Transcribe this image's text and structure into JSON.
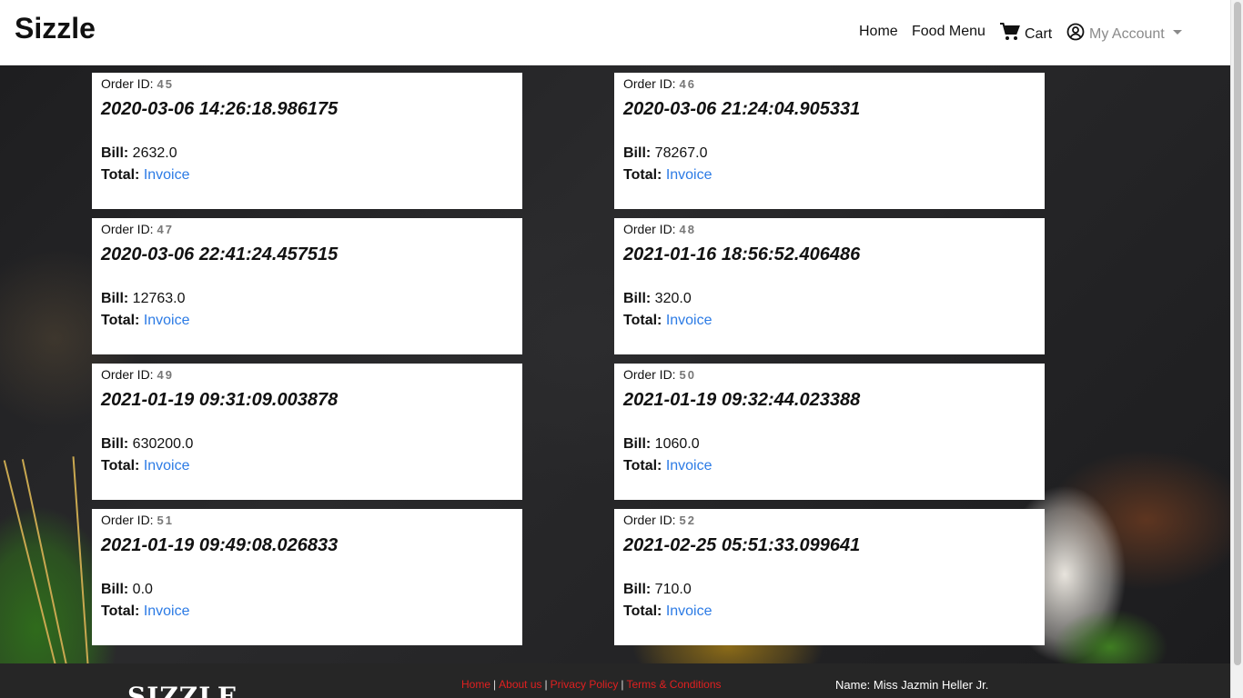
{
  "navbar": {
    "brand": "Sizzle",
    "home": "Home",
    "food_menu": "Food Menu",
    "cart": "Cart",
    "my_account": "My Account"
  },
  "labels": {
    "order_id": "Order ID:",
    "bill": "Bill:",
    "total": "Total:",
    "invoice": "Invoice"
  },
  "orders": [
    {
      "id": "45",
      "timestamp": "2020-03-06 14:26:18.986175",
      "bill": "2632.0"
    },
    {
      "id": "46",
      "timestamp": "2020-03-06 21:24:04.905331",
      "bill": "78267.0"
    },
    {
      "id": "47",
      "timestamp": "2020-03-06 22:41:24.457515",
      "bill": "12763.0"
    },
    {
      "id": "48",
      "timestamp": "2021-01-16 18:56:52.406486",
      "bill": "320.0"
    },
    {
      "id": "49",
      "timestamp": "2021-01-19 09:31:09.003878",
      "bill": "630200.0"
    },
    {
      "id": "50",
      "timestamp": "2021-01-19 09:32:44.023388",
      "bill": "1060.0"
    },
    {
      "id": "51",
      "timestamp": "2021-01-19 09:49:08.026833",
      "bill": "0.0"
    },
    {
      "id": "52",
      "timestamp": "2021-02-25 05:51:33.099641",
      "bill": "710.0"
    }
  ],
  "footer": {
    "logo": "SIZZLE",
    "links": [
      "Home",
      "About us",
      "Privacy Policy",
      "Terms & Conditions"
    ],
    "name": "Name: Miss Jazmin Heller Jr."
  },
  "colors": {
    "link": "#2c7be5",
    "footer_link": "#e02020",
    "footer_bg": "#262626"
  },
  "icons": [
    "cart-icon",
    "user-circle-icon",
    "chevron-down-icon"
  ]
}
